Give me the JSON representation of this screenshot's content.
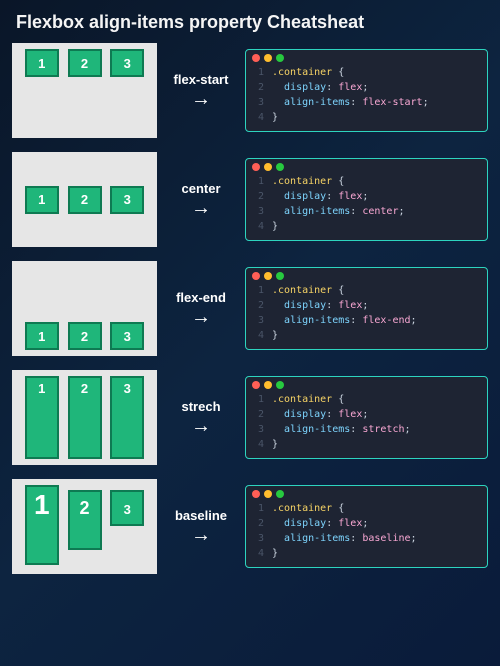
{
  "title": "Flexbox align-items property Cheatsheat",
  "rows": [
    {
      "label": "flex-start",
      "code": {
        "selector": ".container",
        "prop1": "display",
        "val1": "flex",
        "prop2": "align-items",
        "val2": "flex-start"
      },
      "boxes": [
        "1",
        "2",
        "3"
      ]
    },
    {
      "label": "center",
      "code": {
        "selector": ".container",
        "prop1": "display",
        "val1": "flex",
        "prop2": "align-items",
        "val2": "center"
      },
      "boxes": [
        "1",
        "2",
        "3"
      ]
    },
    {
      "label": "flex-end",
      "code": {
        "selector": ".container",
        "prop1": "display",
        "val1": "flex",
        "prop2": "align-items",
        "val2": "flex-end"
      },
      "boxes": [
        "1",
        "2",
        "3"
      ]
    },
    {
      "label": "strech",
      "code": {
        "selector": ".container",
        "prop1": "display",
        "val1": "flex",
        "prop2": "align-items",
        "val2": "stretch"
      },
      "boxes": [
        "1",
        "2",
        "3"
      ]
    },
    {
      "label": "baseline",
      "code": {
        "selector": ".container",
        "prop1": "display",
        "val1": "flex",
        "prop2": "align-items",
        "val2": "baseline"
      },
      "boxes": [
        "1",
        "2",
        "3"
      ]
    }
  ],
  "brace_open": "{",
  "brace_close": "}",
  "semicolon": ";",
  "colon": ":",
  "line_numbers": [
    "1",
    "2",
    "3",
    "4"
  ]
}
